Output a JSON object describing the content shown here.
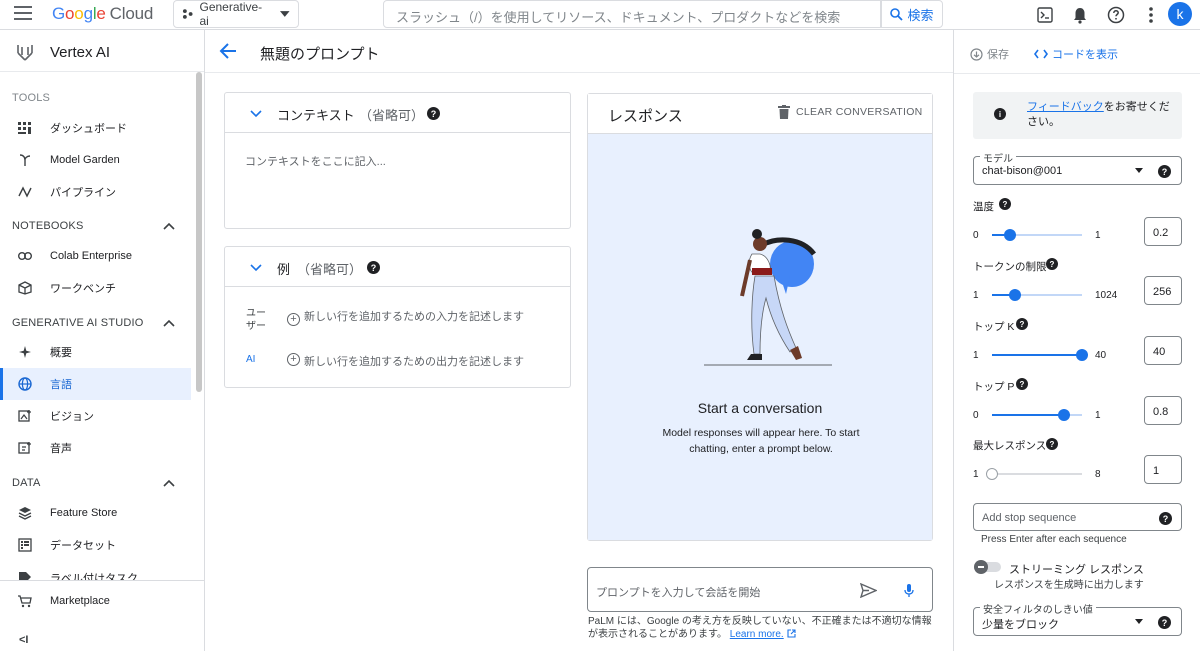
{
  "topbar": {
    "brand_letters": [
      "G",
      "o",
      "o",
      "g",
      "l",
      "e"
    ],
    "brand_product": "Cloud",
    "project": "Generative-ai",
    "search_placeholder": "スラッシュ（/）を使用してリソース、ドキュメント、プロダクトなどを検索",
    "search_button": "検索",
    "icons": [
      "menu-icon",
      "terminal-icon",
      "bell-icon",
      "help-icon",
      "more-vert-icon"
    ],
    "avatar_letter": "k"
  },
  "sidebar": {
    "title": "Vertex AI",
    "sections": [
      {
        "label": "TOOLS",
        "items": [
          {
            "label": "ダッシュボード",
            "icon": "dashboard-icon"
          },
          {
            "label": "Model Garden",
            "icon": "model-garden-icon"
          },
          {
            "label": "パイプライン",
            "icon": "pipeline-icon"
          }
        ]
      },
      {
        "label": "NOTEBOOKS",
        "items": [
          {
            "label": "Colab Enterprise",
            "icon": "colab-icon"
          },
          {
            "label": "ワークベンチ",
            "icon": "workbench-icon"
          }
        ]
      },
      {
        "label": "GENERATIVE AI STUDIO",
        "items": [
          {
            "label": "概要",
            "icon": "sparkle-icon"
          },
          {
            "label": "言語",
            "icon": "language-icon"
          },
          {
            "label": "ビジョン",
            "icon": "vision-icon"
          },
          {
            "label": "音声",
            "icon": "speech-icon"
          }
        ]
      },
      {
        "label": "DATA",
        "items": [
          {
            "label": "Feature Store",
            "icon": "feature-store-icon"
          },
          {
            "label": "データセット",
            "icon": "dataset-icon"
          },
          {
            "label": "ラベル付けタスク",
            "icon": "label-task-icon"
          }
        ]
      }
    ],
    "marketplace": "Marketplace",
    "collapse": "<I"
  },
  "main": {
    "title": "無題のプロンプト",
    "context": {
      "label": "コンテキスト",
      "optional": "（省略可）",
      "placeholder": "コンテキストをここに記入..."
    },
    "examples": {
      "label": "例",
      "optional": "（省略可）",
      "user_label_1": "ユー",
      "user_label_2": "ザー",
      "user_placeholder": "新しい行を追加するための入力を記述します",
      "ai_label": "AI",
      "ai_placeholder": "新しい行を追加するための出力を記述します"
    },
    "response": {
      "title": "レスポンス",
      "clear": "CLEAR CONVERSATION",
      "start_title": "Start a conversation",
      "start_desc": "Model responses will appear here. To start chatting, enter a prompt below."
    },
    "prompt_placeholder": "プロンプトを入力して会話を開始",
    "disclaimer": "PaLM には、Google の考え方を反映していない、不正確または不適切な情報が表示されることがあります。",
    "learn_more": "Learn more."
  },
  "right": {
    "save": "保存",
    "view_code": "コードを表示",
    "feedback_link": "フィードバック",
    "feedback_text": "をお寄せください。",
    "model_label": "モデル",
    "model_value": "chat-bison@001",
    "temperature": {
      "label": "温度",
      "min": "0",
      "max": "1",
      "value": "0.2",
      "fraction": 0.2
    },
    "token_limit": {
      "label": "トークンの制限",
      "min": "1",
      "max": "1024",
      "value": "256",
      "fraction": 0.25
    },
    "top_k": {
      "label": "トップ K",
      "min": "1",
      "max": "40",
      "value": "40",
      "fraction": 1.0
    },
    "top_p": {
      "label": "トップ P",
      "min": "0",
      "max": "1",
      "value": "0.8",
      "fraction": 0.8
    },
    "max_responses": {
      "label": "最大レスポンス",
      "min": "1",
      "max": "8",
      "value": "1",
      "fraction": 0.0
    },
    "stop_placeholder": "Add stop sequence",
    "stop_hint": "Press Enter after each sequence",
    "streaming_label": "ストリーミング レスポンス",
    "streaming_sub": "レスポンスを生成時に出力します",
    "streaming_on": false,
    "safety_label": "安全フィルタのしきい値",
    "safety_value": "少量をブロック"
  },
  "colors": {
    "accent": "#1a73e8",
    "active_bg": "#e8f0fe",
    "response_bg": "#e8f0fe"
  }
}
